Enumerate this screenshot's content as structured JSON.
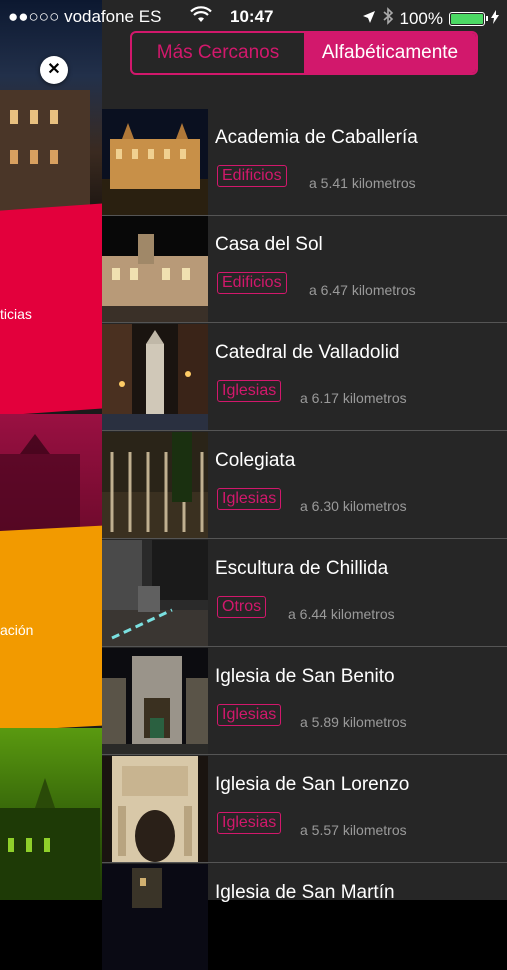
{
  "status_bar": {
    "carrier": "●●○○○ vodafone ES",
    "time": "10:47",
    "battery": "100%"
  },
  "segmented": {
    "option_1": "Más Cercanos",
    "option_2": "Alfabéticamente",
    "selected": "Alfabéticamente"
  },
  "side_menu": {
    "label_1": "ticias",
    "label_2": "ación",
    "close_symbol": "✕"
  },
  "colors": {
    "accent": "#d2186c",
    "red_panel": "#e3003c",
    "orange_panel": "#f29a00",
    "green_panel": "#5a9a10",
    "magenta_panel": "#9a1042"
  },
  "places": [
    {
      "name": "Academia de Caballería",
      "category": "Edificios",
      "distance": "a 5.41 kilometros"
    },
    {
      "name": "Casa del Sol",
      "category": "Edificios",
      "distance": "a 6.47 kilometros"
    },
    {
      "name": "Catedral de Valladolid",
      "category": "Iglesias",
      "distance": "a 6.17 kilometros"
    },
    {
      "name": "Colegiata",
      "category": "Iglesias",
      "distance": "a 6.30 kilometros"
    },
    {
      "name": "Escultura de Chillida",
      "category": "Otros",
      "distance": "a 6.44 kilometros"
    },
    {
      "name": "Iglesia de San Benito",
      "category": "Iglesias",
      "distance": "a 5.89 kilometros"
    },
    {
      "name": "Iglesia de San Lorenzo",
      "category": "Iglesias",
      "distance": "a 5.57 kilometros"
    },
    {
      "name": "Iglesia de San Martín",
      "category": "",
      "distance": ""
    }
  ]
}
